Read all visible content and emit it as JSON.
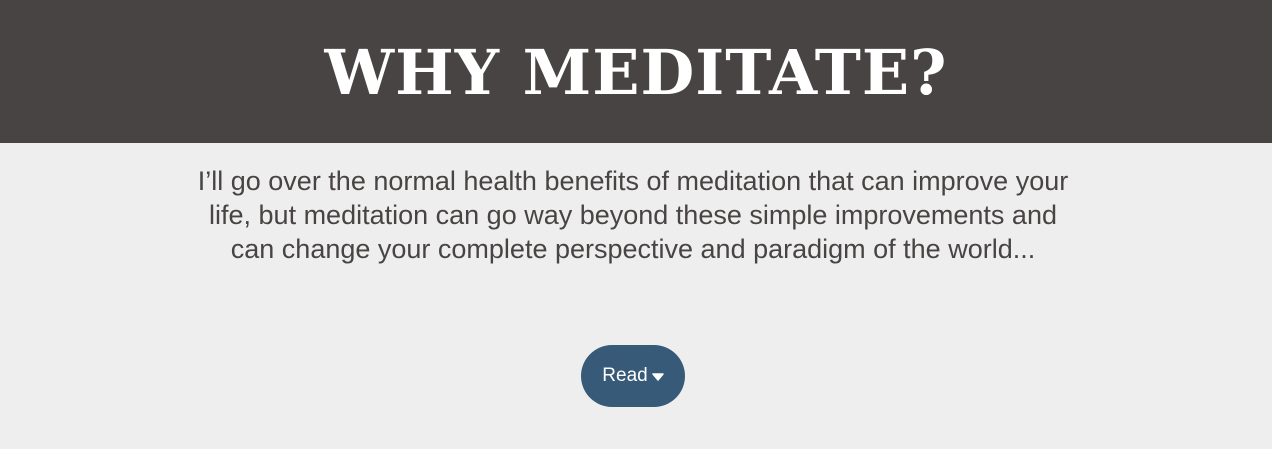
{
  "header": {
    "title": "WHY MEDITATE?"
  },
  "main": {
    "intro": "I’ll go over the normal health benefits of meditation that can improve your life, but meditation can go way beyond these simple improvements and can change your complete perspective and paradigm of the world...",
    "read_label": "Read",
    "read_icon": "chevron-down-icon"
  },
  "colors": {
    "header_bg": "#484443",
    "page_bg": "#eeeeee",
    "text": "#484443",
    "button_bg": "#365a78",
    "button_text": "#ffffff"
  }
}
